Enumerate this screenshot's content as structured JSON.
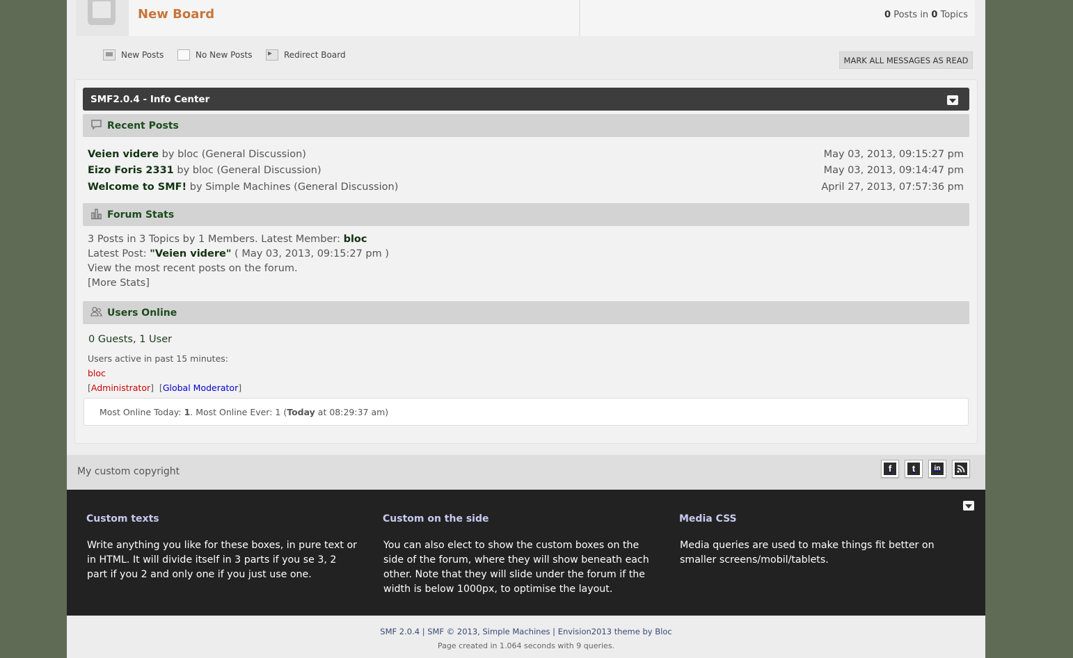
{
  "board": {
    "name": "New Board",
    "posts_count": "0",
    "posts_label": "Posts in",
    "topics_count": "0",
    "topics_label": "Topics"
  },
  "legend": {
    "new_posts": "New Posts",
    "no_new_posts": "No New Posts",
    "redirect_board": "Redirect Board"
  },
  "mark_all_read": "MARK ALL MESSAGES AS READ",
  "info_center": {
    "title": "SMF2.0.4 - Info Center",
    "recent_posts": {
      "title": "Recent Posts",
      "items": [
        {
          "subject": "Veien videre",
          "by": "by",
          "author": "bloc",
          "board": "(General Discussion)",
          "date": "May 03, 2013, 09:15:27 pm"
        },
        {
          "subject": "Eizo Foris 2331",
          "by": "by",
          "author": "bloc",
          "board": "(General Discussion)",
          "date": "May 03, 2013, 09:14:47 pm"
        },
        {
          "subject": "Welcome to SMF!",
          "by": "by",
          "author": "Simple Machines",
          "board": "(General Discussion)",
          "date": "April 27, 2013, 07:57:36 pm"
        }
      ]
    },
    "forum_stats": {
      "title": "Forum Stats",
      "summary": "3 Posts in 3 Topics by 1 Members. Latest Member:",
      "latest_member": "bloc",
      "latest_post_label": "Latest Post:",
      "latest_post_subject": "\"Veien videre\"",
      "latest_post_date": "( May 03, 2013, 09:15:27 pm )",
      "recent_link": "View the most recent posts on the forum.",
      "more_stats": "[More Stats]"
    },
    "users_online": {
      "title": "Users Online",
      "counts": "0 Guests, 1 User",
      "active_label": "Users active in past 15 minutes:",
      "user": "bloc",
      "group_admin": "Administrator",
      "group_mod": "Global Moderator",
      "most_today_label": "Most Online Today:",
      "most_today_value": "1",
      "most_ever_label": ". Most Online Ever: 1 (",
      "most_ever_today": "Today",
      "most_ever_time": " at 08:29:37 am)"
    }
  },
  "copyright": "My custom copyright",
  "social": {
    "facebook": "f",
    "twitter": "t",
    "linkedin": "in"
  },
  "footer_boxes": [
    {
      "title": "Custom texts",
      "text": "Write anything you like for these boxes, in pure text or in HTML. It will divide itself in 3 parts if you se 3, 2 part if you 2 and only one if you just use one."
    },
    {
      "title": "Custom on the side",
      "text": "You can also elect to show the custom boxes on the side of the forum, where they will show beneath each other. Note that they will slide under the forum if the width is below 1000px, to optimise the layout."
    },
    {
      "title": "Media CSS",
      "text": "Media queries are used to make things fit better on smaller screens/mobil/tablets."
    }
  ],
  "bottom": {
    "credits": "SMF 2.0.4 | SMF © 2013, Simple Machines | Envision2013 theme by Bloc",
    "page_created": "Page created in 1.064 seconds with 9 queries."
  },
  "colors": {
    "background": "#5f6b55",
    "board_link": "#c8753a",
    "header_dark": "#3d3d3d",
    "section_title": "#1d4b1d",
    "admin_red": "#cc0000",
    "moderator_blue": "#0000cc",
    "footer_dark": "#222222"
  },
  "icons": [
    "board-icon",
    "new-posts-icon",
    "no-new-posts-icon",
    "redirect-icon",
    "chat-bubble-icon",
    "bar-chart-icon",
    "users-icon",
    "chevron-down-icon",
    "facebook-icon",
    "twitter-icon",
    "linkedin-icon",
    "rss-icon"
  ]
}
